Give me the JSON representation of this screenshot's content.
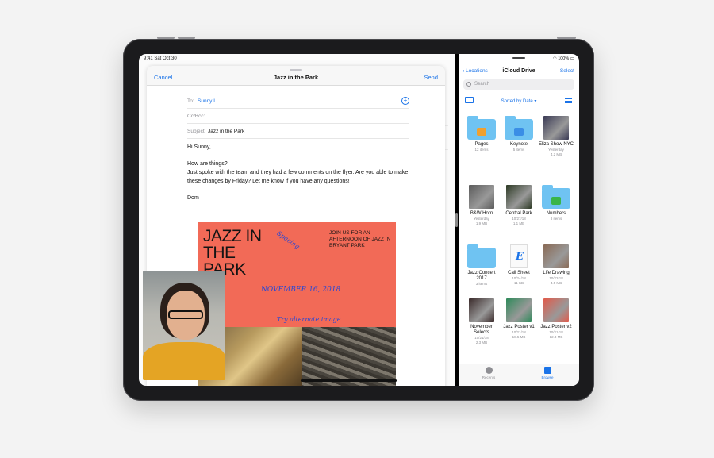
{
  "left_pane": {
    "status_time": "9:41 Sat Oct 30",
    "compose": {
      "cancel_label": "Cancel",
      "title": "Jazz in the Park",
      "send_label": "Send",
      "to_label": "To:",
      "to_value": "Sunny Li",
      "ccbcc_label": "Cc/Bcc:",
      "subject_label": "Subject:",
      "subject_value": "Jazz in the Park",
      "body": {
        "greeting": "Hi Sunny,",
        "line1": "How are things?",
        "line2": "Just spoke with the team and they had a few comments on the flyer. Are you able to make these changes by Friday? Let me know if you have any questions!",
        "signoff": "Dom"
      },
      "flyer": {
        "headline": "JAZZ IN THE PARK",
        "join_text": "JOIN US FOR AN AFTERNOON OF JAZZ IN BRYANT PARK",
        "note_spacing": "Spacing",
        "note_date": "NOVEMBER 16, 2018",
        "note_image": "Try alternate image"
      }
    }
  },
  "right_pane": {
    "status_battery": "100%",
    "nav": {
      "back_label": "Locations",
      "title": "iCloud Drive",
      "select_label": "Select"
    },
    "search_placeholder": "Search",
    "sort_label": "Sorted by Date ▾",
    "files": [
      {
        "name": "Pages",
        "meta1": "12 items",
        "meta2": "",
        "kind": "folder",
        "glyph_color": "#f0a030"
      },
      {
        "name": "Keynote",
        "meta1": "5 items",
        "meta2": "",
        "kind": "folder",
        "glyph_color": "#3a8ee6"
      },
      {
        "name": "Eliza Show NYC",
        "meta1": "Yesterday",
        "meta2": "4.2 MB",
        "kind": "photo",
        "color": "#3a3a55"
      },
      {
        "name": "B&W Horn",
        "meta1": "Yesterday",
        "meta2": "1.9 MB",
        "kind": "photo",
        "color": "#5b5b5b"
      },
      {
        "name": "Central Park",
        "meta1": "10/27/18",
        "meta2": "1.1 MB",
        "kind": "photo",
        "color": "#2d3a25"
      },
      {
        "name": "Numbers",
        "meta1": "8 items",
        "meta2": "",
        "kind": "folder",
        "glyph_color": "#39b54a"
      },
      {
        "name": "Jazz Concert 2017",
        "meta1": "3 items",
        "meta2": "",
        "kind": "folder",
        "glyph_color": ""
      },
      {
        "name": "Call Sheet",
        "meta1": "10/24/18",
        "meta2": "11 KB",
        "kind": "doc",
        "color": "#1a73e8"
      },
      {
        "name": "Life Drawing",
        "meta1": "10/22/18",
        "meta2": "4.5 MB",
        "kind": "photo",
        "color": "#8a6a55"
      },
      {
        "name": "November Selects",
        "meta1": "10/21/18",
        "meta2": "2.3 MB",
        "kind": "photo",
        "color": "#3a2a2a"
      },
      {
        "name": "Jazz Poster v1",
        "meta1": "10/21/18",
        "meta2": "18.5 MB",
        "kind": "photo",
        "color": "#2e8a5a"
      },
      {
        "name": "Jazz Poster v2",
        "meta1": "10/21/18",
        "meta2": "12.3 MB",
        "kind": "photo",
        "color": "#e25a4a"
      }
    ],
    "tabs": [
      {
        "label": "Recents"
      },
      {
        "label": "Browse"
      }
    ]
  }
}
